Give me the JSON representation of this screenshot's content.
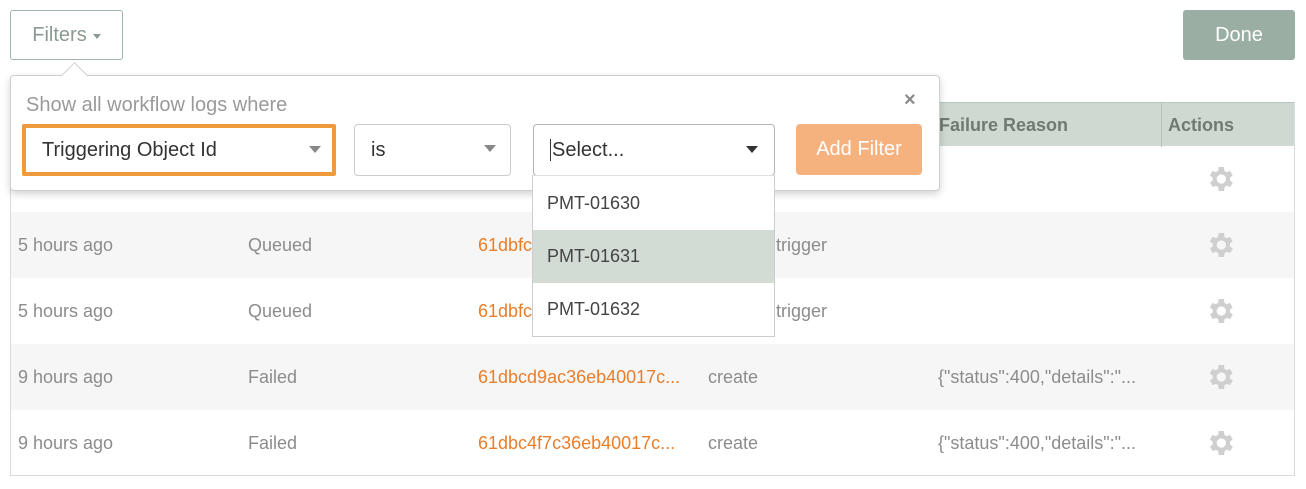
{
  "toolbar": {
    "filters_label": "Filters",
    "done_label": "Done"
  },
  "filter_popover": {
    "title": "Show all workflow logs where",
    "close_glyph": "×",
    "field_select": "Triggering Object Id",
    "operator_select": "is",
    "value_placeholder": "Select...",
    "add_filter_label": "Add Filter",
    "options": [
      "PMT-01630",
      "PMT-01631",
      "PMT-01632"
    ],
    "highlighted_option": "PMT-01631"
  },
  "table": {
    "visible_headers": [
      "Failure Reason",
      "Actions"
    ],
    "rows": [
      {
        "time": "",
        "status": "",
        "id": "",
        "type": "",
        "reason": ""
      },
      {
        "time": "5 hours ago",
        "status": "Queued",
        "id": "61dbfc",
        "type": "trigger",
        "reason": ""
      },
      {
        "time": "5 hours ago",
        "status": "Queued",
        "id": "61dbfc",
        "type": "trigger",
        "reason": ""
      },
      {
        "time": "9 hours ago",
        "status": "Failed",
        "id": "61dbcd9ac36eb40017c...",
        "type": "create",
        "reason": "{\"status\":400,\"details\":\"..."
      },
      {
        "time": "9 hours ago",
        "status": "Failed",
        "id": "61dbc4f7c36eb40017c...",
        "type": "create",
        "reason": "{\"status\":400,\"details\":\"..."
      }
    ]
  },
  "colors": {
    "accent": "#e87e2a",
    "header_bg": "#ced9d1",
    "done_bg": "#9aaea3",
    "focus_border": "#f09a3e"
  }
}
